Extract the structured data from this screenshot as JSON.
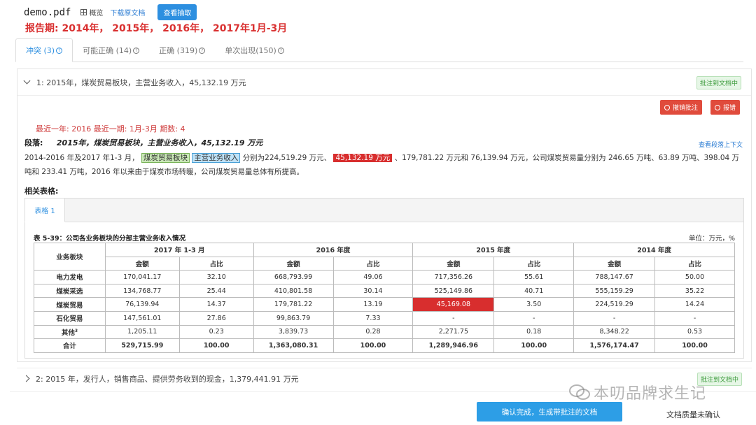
{
  "header": {
    "filename": "demo.pdf",
    "overview": "概览",
    "download": "下载原文档",
    "view_extract": "查看抽取"
  },
  "report_period": "报告期:  2014年，  2015年，  2016年，  2017年1月-3月",
  "tabs": [
    {
      "label": "冲突 (3)"
    },
    {
      "label": "可能正确 (14)"
    },
    {
      "label": "正确 (319)"
    },
    {
      "label": "单次出现(150)"
    }
  ],
  "item1": {
    "title": "1:  2015年，煤炭贸易板块，主营业务收入，45,132.19 万元",
    "tag": "批注到文档中",
    "undo_button": "撤销批注",
    "report_button": "报错",
    "meta": "最近一年: 2016    最近一期: 1月-3月    期数: 4",
    "para_label": "段落:",
    "para_summary": "2015年，煤炭贸易板块，主营业务收入，45,132.19 万元",
    "context_link": "查看段落上下文",
    "text_a": "2014-2016 年及2017 年1-3 月，",
    "hl1": "煤炭贸易板块",
    "hl2": "主营业务收入",
    "text_b": "分别为224,519.29 万元、",
    "hl3": "45,132.19 万元",
    "text_c": "、179,781.22 万元和 76,139.94 万元，公司煤炭贸易量分别为 246.65 万吨、63.89 万吨、398.04 万吨和 233.41 万吨，2016 年以来由于煤炭市场转暖，公司煤炭贸易量总体有所提高。",
    "related": "相关表格:",
    "table_tab": "表格 1",
    "table": {
      "title": "表 5-39：公司各业务板块的分部主营业务收入情况",
      "unit": "单位：万元，%",
      "col_segment": "业务板块",
      "periods": [
        "2017 年 1-3 月",
        "2016 年度",
        "2015 年度",
        "2014 年度"
      ],
      "sub_amount": "金额",
      "sub_ratio": "占比",
      "rows": [
        {
          "name": "电力发电",
          "cells": [
            "170,041.17",
            "32.10",
            "668,793.99",
            "49.06",
            "717,356.26",
            "55.61",
            "788,147.67",
            "50.00"
          ]
        },
        {
          "name": "煤炭采选",
          "cells": [
            "134,768.77",
            "25.44",
            "410,801.58",
            "30.14",
            "525,149.86",
            "40.71",
            "555,159.29",
            "35.22"
          ]
        },
        {
          "name": "煤炭贸易",
          "cells": [
            "76,139.94",
            "14.37",
            "179,781.22",
            "13.19",
            "45,169.08",
            "3.50",
            "224,519.29",
            "14.24"
          ]
        },
        {
          "name": "石化贸易",
          "cells": [
            "147,561.01",
            "27.86",
            "99,863.79",
            "7.33",
            "-",
            "-",
            "-",
            "-"
          ]
        },
        {
          "name": "其他",
          "sup": "3",
          "cells": [
            "1,205.11",
            "0.23",
            "3,839.73",
            "0.28",
            "2,271.75",
            "0.18",
            "8,348.22",
            "0.53"
          ]
        },
        {
          "name": "合计",
          "cells": [
            "529,715.99",
            "100.00",
            "1,363,080.31",
            "100.00",
            "1,289,946.96",
            "100.00",
            "1,576,174.47",
            "100.00"
          ]
        }
      ]
    }
  },
  "item2": {
    "title": "2:  2015 年，发行人，销售商品、提供劳务收到的现金，1,379,441.91 万元",
    "tag": "批注到文档中"
  },
  "footer": {
    "confirm": "确认完成，生成带批注的文档",
    "quality": "文档质量未确认"
  },
  "watermark": "本叨品牌求生记",
  "colors": {
    "accent": "#2d8fe0",
    "alert": "#d82e2e",
    "success": "#3a9a3a"
  }
}
